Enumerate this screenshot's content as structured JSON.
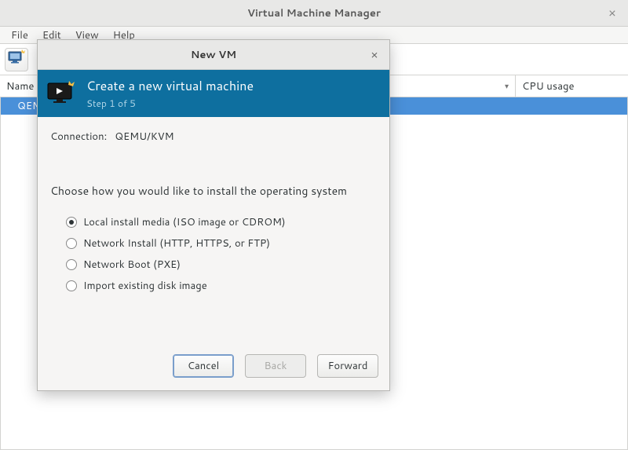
{
  "window": {
    "title": "Virtual Machine Manager",
    "close_glyph": "×"
  },
  "menubar": {
    "file": "File",
    "edit": "Edit",
    "view": "View",
    "help": "Help"
  },
  "table": {
    "name_header": "Name",
    "cpu_header": "CPU usage",
    "sort_glyph": "▾",
    "row0": "QEMU"
  },
  "dialog": {
    "title": "New VM",
    "close_glyph": "×",
    "heading": "Create a new virtual machine",
    "step": "Step 1 of 5",
    "connection_label": "Connection:",
    "connection_value": "QEMU/KVM",
    "prompt": "Choose how you would like to install the operating system",
    "options": {
      "local": "Local install media (ISO image or CDROM)",
      "network_install": "Network Install (HTTP, HTTPS, or FTP)",
      "network_boot": "Network Boot (PXE)",
      "import": "Import existing disk image"
    },
    "selected_option": "local",
    "buttons": {
      "cancel": "Cancel",
      "back": "Back",
      "forward": "Forward"
    }
  }
}
